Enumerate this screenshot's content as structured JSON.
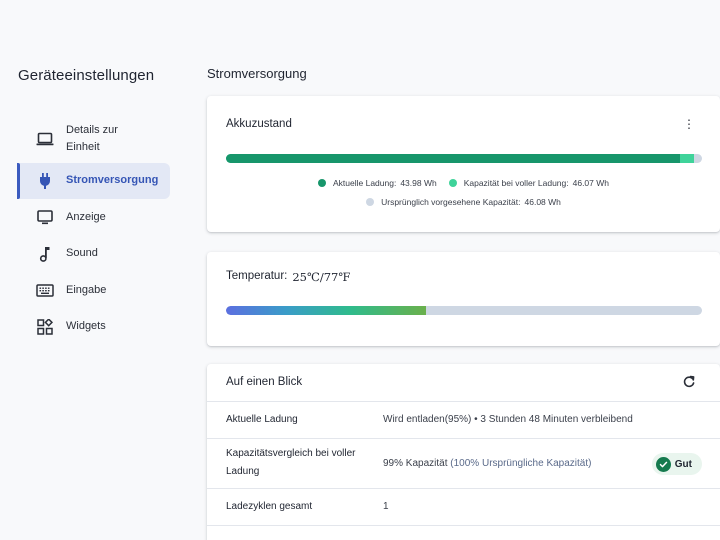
{
  "sidebar": {
    "title": "Geräteeinstellungen",
    "items": [
      {
        "label": "Details zur Einheit",
        "icon": "laptop-icon",
        "active": false
      },
      {
        "label": "Stromversorgung",
        "icon": "power-plug-icon",
        "active": true
      },
      {
        "label": "Anzeige",
        "icon": "monitor-icon",
        "active": false
      },
      {
        "label": "Sound",
        "icon": "music-note-icon",
        "active": false
      },
      {
        "label": "Eingabe",
        "icon": "keyboard-icon",
        "active": false
      },
      {
        "label": "Widgets",
        "icon": "widgets-icon",
        "active": false
      }
    ]
  },
  "main": {
    "section_title": "Stromversorgung",
    "battery": {
      "heading": "Akkuzustand",
      "current_fraction_of_design": 0.9547,
      "full_fraction_of_design": 1.0,
      "legend": {
        "current_label": "Aktuelle Ladung:",
        "current_value": "43.98 Wh",
        "full_label": "Kapazität bei voller Ladung:",
        "full_value": "46.07 Wh",
        "design_label": "Ursprünglich vorgesehene Kapazität:",
        "design_value": "46.08 Wh"
      }
    },
    "temperature": {
      "label": "Temperatur:",
      "value": "25℃/77℉",
      "fill_fraction": 0.42
    },
    "glance": {
      "heading": "Auf einen Blick",
      "rows": [
        {
          "label": "Aktuelle Ladung",
          "value": "Wird entladen(95%)  •  3 Stunden 48 Minuten verbleibend"
        },
        {
          "label": "Kapazitätsvergleich bei voller Ladung",
          "value_main": "99% Kapazität",
          "value_muted": "(100% Ursprüngliche Kapazität)",
          "badge": "Gut"
        },
        {
          "label": "Ladezyklen gesamt",
          "value": "1"
        }
      ]
    }
  },
  "colors": {
    "accent": "#3b5bbf",
    "current_charge": "#17966b",
    "full_capacity": "#3fd39a",
    "design_capacity": "#ced7e3",
    "badge_green": "#157a4e"
  }
}
